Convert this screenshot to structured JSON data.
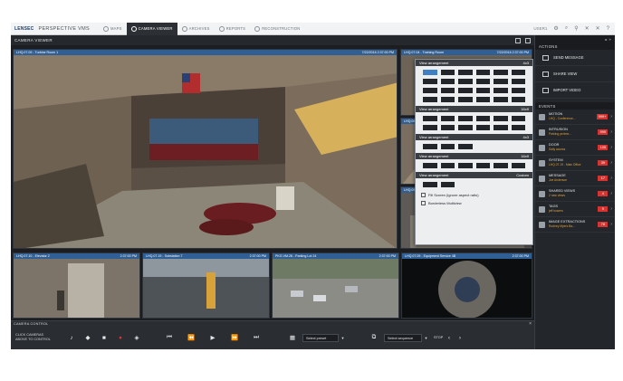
{
  "topbar": {
    "logo": "LENSEC",
    "product": "PERSPECTIVE VMS",
    "tabs": [
      {
        "label": "MAPS",
        "active": false
      },
      {
        "label": "CAMERA VIEWER",
        "active": true
      },
      {
        "label": "ARCHIVES",
        "active": false
      },
      {
        "label": "REPORTS",
        "active": false
      },
      {
        "label": "RECONSTRUCTION",
        "active": false
      }
    ],
    "user": "USER1"
  },
  "header": {
    "title": "CAMERA VIEWER"
  },
  "main_camera": {
    "name": "LHQ.07.09 - Turbine Room 1",
    "timestamp": "7/22/2016 2:37:00 PM"
  },
  "right_cameras": [
    {
      "name": "LHQ.07.04 - Training Room",
      "timestamp": "7/22/2016 2:37:00 PM"
    },
    {
      "name": "LHQ.06.12 - Lobby",
      "timestamp": "2:37:00 PM"
    },
    {
      "name": "LHQ.05.02 - Hallway",
      "timestamp": "2:37:00 PM"
    }
  ],
  "bottom_cameras": [
    {
      "name": "LHQ.07.10 - Elevator 2",
      "timestamp": "2:37:00 PM"
    },
    {
      "name": "LHQ.07.19 - Substation 7",
      "timestamp": "2:37:00 PM"
    },
    {
      "name": "PKG.VM.26 - Parking Lot 24",
      "timestamp": "2:37:00 PM"
    },
    {
      "name": "LHQ.07.09 - Equipment Service 4B",
      "timestamp": "2:37:00 PM"
    }
  ],
  "view_popup": {
    "sections": [
      "View arrangement",
      "View arrangement",
      "View arrangement",
      "View arrangement",
      "View arrangement"
    ],
    "sizes": [
      "4x3",
      "16x9",
      "4x3",
      "16x9",
      "Custom"
    ],
    "options": [
      "Fill Screen (ignore aspect ratio)",
      "Borderless Multiview"
    ]
  },
  "sidebar": {
    "actions_title": "ACTIONS",
    "actions": [
      "SEND MESSAGE",
      "SHARE VIEW",
      "IMPORT VIDEO"
    ],
    "events_title": "EVENTS",
    "events": [
      {
        "name": "MOTION",
        "sub": "LHQ - Conference...",
        "count": "999+"
      },
      {
        "name": "INTRUSION",
        "sub": "Parking perime...",
        "count": "999"
      },
      {
        "name": "DOOR",
        "sub": "Sally access",
        "count": "105"
      },
      {
        "name": "SYSTEM",
        "sub": "LHQ.07.19 - Main Office",
        "count": "39"
      },
      {
        "name": "MESSAGE",
        "sub": "Joe Anderson",
        "count": "17"
      },
      {
        "name": "SHARED VIEWS",
        "sub": "2 new views",
        "count": "4"
      },
      {
        "name": "TAGS",
        "sub": "jeff bowers",
        "count": "9"
      },
      {
        "name": "IMAGE EXTRACTIONS",
        "sub": "Rodney Myers Ba...",
        "count": "78"
      }
    ]
  },
  "control": {
    "label": "CAMERA CONTROL",
    "hint": "CLICK CAMERAS ABOVE TO CONTROL",
    "preset_label": "Select preset",
    "sequence_label": "Select sequence",
    "sequence_stop": "STOP"
  },
  "colors": {
    "accent": "#2f5f94",
    "alert": "#d63431",
    "background": "#1b1d20"
  }
}
